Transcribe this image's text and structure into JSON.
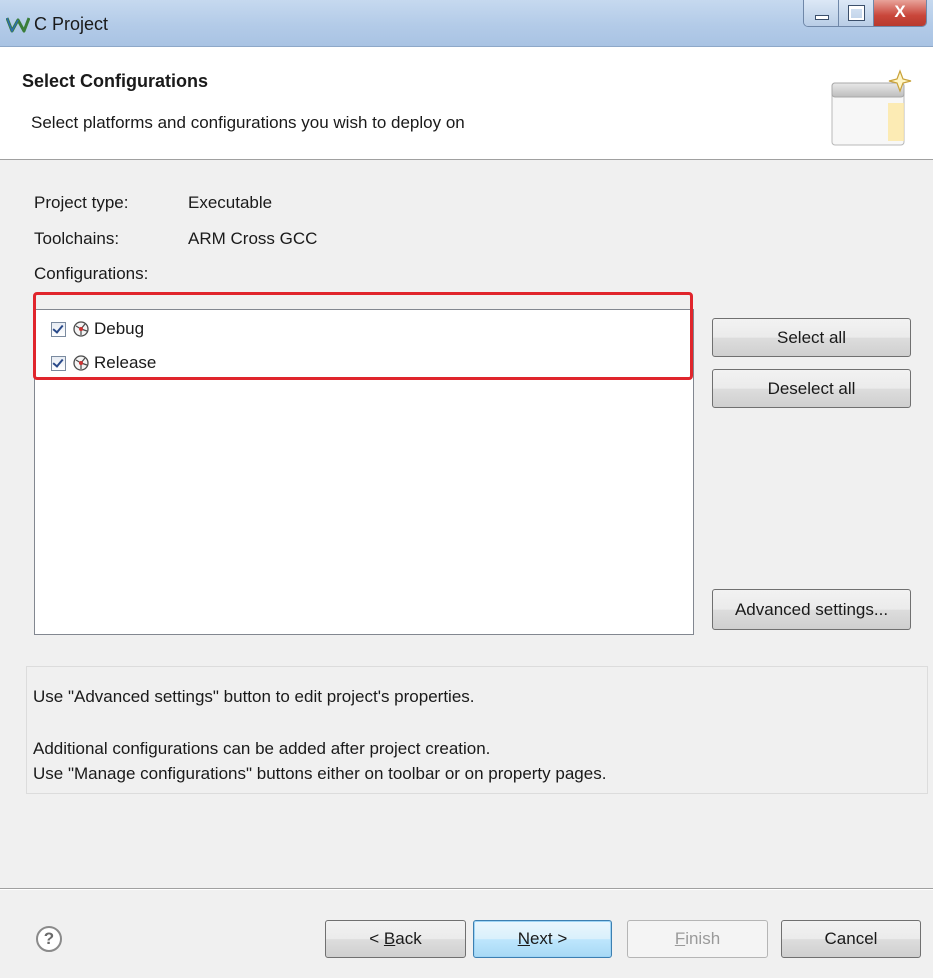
{
  "window": {
    "title": "C Project",
    "app_icon": "wavy-w-icon",
    "controls": [
      "minimize-icon",
      "maximize-icon",
      "close-icon"
    ],
    "close_glyph": "X"
  },
  "header": {
    "title": "Select Configurations",
    "description": "Select platforms and configurations you wish to deploy on",
    "graphic": "wizard-window-sparkle-icon"
  },
  "project": {
    "type_label": "Project type:",
    "type_value": "Executable",
    "toolchains_label": "Toolchains:",
    "toolchains_value": "ARM Cross GCC",
    "configurations_label": "Configurations:"
  },
  "configurations": [
    {
      "label": "Debug",
      "checked": true,
      "icon": "config-gear-icon"
    },
    {
      "label": "Release",
      "checked": true,
      "icon": "config-gear-icon"
    }
  ],
  "highlight_color": "#e0252c",
  "side_buttons": {
    "select_all": "Select all",
    "deselect_all": "Deselect all",
    "advanced": "Advanced settings..."
  },
  "info": {
    "line1": "Use \"Advanced settings\" button to edit project's properties.",
    "line2": "Additional configurations can be added after project creation.",
    "line3": "Use \"Manage configurations\" buttons either on toolbar or on property pages."
  },
  "footer": {
    "help_glyph": "?",
    "back_prefix": "< ",
    "back_mnemonic": "B",
    "back_rest": "ack",
    "next_mnemonic": "N",
    "next_rest": "ext >",
    "finish_mnemonic": "F",
    "finish_rest": "inish",
    "finish_enabled": false,
    "cancel": "Cancel"
  }
}
